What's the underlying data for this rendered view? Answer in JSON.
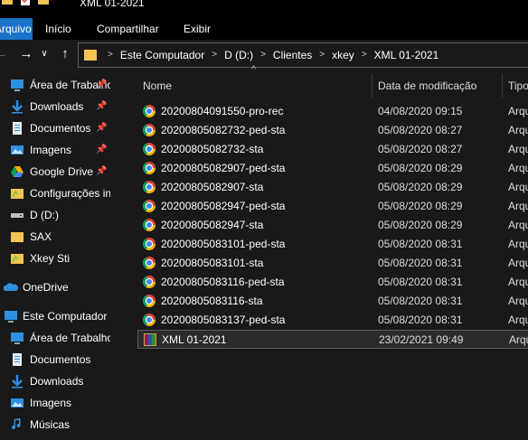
{
  "window": {
    "title": "XML 01-2021"
  },
  "ribbon": {
    "tabs": [
      "Arquivo",
      "Início",
      "Compartilhar",
      "Exibir"
    ]
  },
  "address": {
    "crumbs": [
      "Este Computador",
      "D (D:)",
      "Clientes",
      "xkey",
      "XML 01-2021"
    ]
  },
  "sidebar": {
    "quick_access": [
      {
        "label": "Área de Trabalho",
        "icon": "desktop-icon",
        "pinned": true
      },
      {
        "label": "Downloads",
        "icon": "download-icon",
        "pinned": true
      },
      {
        "label": "Documentos",
        "icon": "documents-icon",
        "pinned": true
      },
      {
        "label": "Imagens",
        "icon": "images-icon",
        "pinned": true
      },
      {
        "label": "Google Drive",
        "icon": "google-drive-icon",
        "pinned": true
      },
      {
        "label": "Configurações iniciais",
        "icon": "folder-icon",
        "pinned": false
      },
      {
        "label": "D (D:)",
        "icon": "drive-icon",
        "pinned": false
      },
      {
        "label": "SAX",
        "icon": "folder-icon",
        "pinned": false
      },
      {
        "label": "Xkey Sti",
        "icon": "folder-icon",
        "pinned": false
      }
    ],
    "onedrive": "OneDrive",
    "this_pc": "Este Computador",
    "this_pc_items": [
      {
        "label": "Área de Trabalho",
        "icon": "desktop-icon"
      },
      {
        "label": "Documentos",
        "icon": "documents-icon"
      },
      {
        "label": "Downloads",
        "icon": "download-icon"
      },
      {
        "label": "Imagens",
        "icon": "images-icon"
      },
      {
        "label": "Músicas",
        "icon": "music-icon"
      }
    ]
  },
  "columns": {
    "name": "Nome",
    "date": "Data de modificação",
    "type": "Tipo"
  },
  "files": [
    {
      "name": "20200804091550-pro-rec",
      "date": "04/08/2020 09:15",
      "type": "Arquivo",
      "icon": "chrome-icon"
    },
    {
      "name": "20200805082732-ped-sta",
      "date": "05/08/2020 08:27",
      "type": "Arquivo",
      "icon": "chrome-icon"
    },
    {
      "name": "20200805082732-sta",
      "date": "05/08/2020 08:27",
      "type": "Arquivo",
      "icon": "chrome-icon"
    },
    {
      "name": "20200805082907-ped-sta",
      "date": "05/08/2020 08:29",
      "type": "Arquivo",
      "icon": "chrome-icon"
    },
    {
      "name": "20200805082907-sta",
      "date": "05/08/2020 08:29",
      "type": "Arquivo",
      "icon": "chrome-icon"
    },
    {
      "name": "20200805082947-ped-sta",
      "date": "05/08/2020 08:29",
      "type": "Arquivo",
      "icon": "chrome-icon"
    },
    {
      "name": "20200805082947-sta",
      "date": "05/08/2020 08:29",
      "type": "Arquivo",
      "icon": "chrome-icon"
    },
    {
      "name": "20200805083101-ped-sta",
      "date": "05/08/2020 08:31",
      "type": "Arquivo",
      "icon": "chrome-icon"
    },
    {
      "name": "20200805083101-sta",
      "date": "05/08/2020 08:31",
      "type": "Arquivo",
      "icon": "chrome-icon"
    },
    {
      "name": "20200805083116-ped-sta",
      "date": "05/08/2020 08:31",
      "type": "Arquivo",
      "icon": "chrome-icon"
    },
    {
      "name": "20200805083116-sta",
      "date": "05/08/2020 08:31",
      "type": "Arquivo",
      "icon": "chrome-icon"
    },
    {
      "name": "20200805083137-ped-sta",
      "date": "05/08/2020 08:31",
      "type": "Arquivo",
      "icon": "chrome-icon"
    },
    {
      "name": "XML 01-2021",
      "date": "23/02/2021 09:49",
      "type": "Arquivo",
      "icon": "winrar-archive-icon",
      "selected": true
    }
  ],
  "colors": {
    "accent": "#1a73c8",
    "background": "#191919",
    "folder": "#f4c453"
  }
}
